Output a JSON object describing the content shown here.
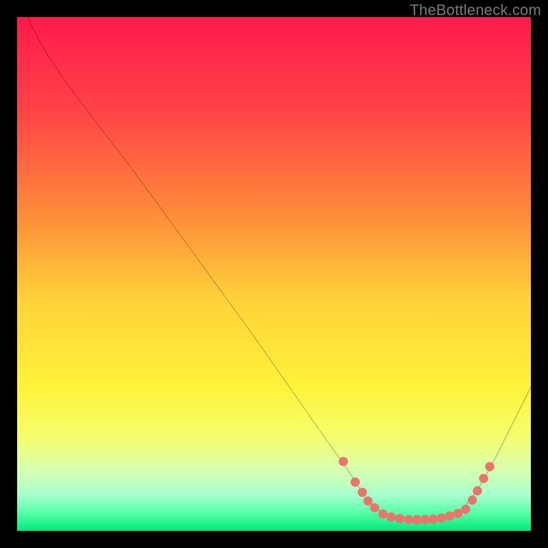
{
  "watermark": "TheBottleneck.com",
  "chart_data": {
    "type": "line",
    "xlabel": "",
    "ylabel": "",
    "xlim": [
      0,
      100
    ],
    "ylim": [
      0,
      100
    ],
    "grid": false,
    "background_gradient_stops": [
      {
        "offset": 0.0,
        "color": "#ff1a4b"
      },
      {
        "offset": 0.18,
        "color": "#ff4247"
      },
      {
        "offset": 0.38,
        "color": "#ff8a3a"
      },
      {
        "offset": 0.55,
        "color": "#ffd23a"
      },
      {
        "offset": 0.72,
        "color": "#fff23a"
      },
      {
        "offset": 0.82,
        "color": "#f4ff70"
      },
      {
        "offset": 0.88,
        "color": "#d8ffb0"
      },
      {
        "offset": 0.93,
        "color": "#a8ffd0"
      },
      {
        "offset": 0.965,
        "color": "#55ffa8"
      },
      {
        "offset": 1.0,
        "color": "#00e87a"
      }
    ],
    "series": [
      {
        "name": "bottleneck-curve",
        "color": "#000000",
        "points": [
          {
            "x": 2,
            "y": 100
          },
          {
            "x": 5,
            "y": 94
          },
          {
            "x": 9,
            "y": 88
          },
          {
            "x": 15,
            "y": 80
          },
          {
            "x": 22,
            "y": 71
          },
          {
            "x": 30,
            "y": 60
          },
          {
            "x": 38,
            "y": 49
          },
          {
            "x": 46,
            "y": 38
          },
          {
            "x": 53,
            "y": 28
          },
          {
            "x": 60,
            "y": 18
          },
          {
            "x": 65,
            "y": 11
          },
          {
            "x": 68,
            "y": 6
          },
          {
            "x": 71,
            "y": 3.5
          },
          {
            "x": 74,
            "y": 2.5
          },
          {
            "x": 77,
            "y": 2.2
          },
          {
            "x": 80,
            "y": 2.2
          },
          {
            "x": 83,
            "y": 2.5
          },
          {
            "x": 86,
            "y": 3.5
          },
          {
            "x": 89,
            "y": 7
          },
          {
            "x": 92,
            "y": 12
          },
          {
            "x": 96,
            "y": 20
          },
          {
            "x": 100,
            "y": 28
          }
        ]
      }
    ],
    "markers": {
      "color": "#e9766a",
      "radius_pct": 0.9,
      "points": [
        {
          "x": 63.5,
          "y": 13.5
        },
        {
          "x": 65.8,
          "y": 9.5
        },
        {
          "x": 67.2,
          "y": 7.5
        },
        {
          "x": 68.3,
          "y": 5.8
        },
        {
          "x": 69.6,
          "y": 4.5
        },
        {
          "x": 71.2,
          "y": 3.3
        },
        {
          "x": 72.8,
          "y": 2.7
        },
        {
          "x": 74.5,
          "y": 2.4
        },
        {
          "x": 76.2,
          "y": 2.2
        },
        {
          "x": 77.8,
          "y": 2.2
        },
        {
          "x": 79.4,
          "y": 2.2
        },
        {
          "x": 81.0,
          "y": 2.3
        },
        {
          "x": 82.6,
          "y": 2.5
        },
        {
          "x": 84.2,
          "y": 2.9
        },
        {
          "x": 85.8,
          "y": 3.4
        },
        {
          "x": 87.3,
          "y": 4.2
        },
        {
          "x": 88.6,
          "y": 6.0
        },
        {
          "x": 89.6,
          "y": 7.8
        },
        {
          "x": 90.8,
          "y": 10.2
        },
        {
          "x": 92.0,
          "y": 12.5
        }
      ]
    }
  }
}
